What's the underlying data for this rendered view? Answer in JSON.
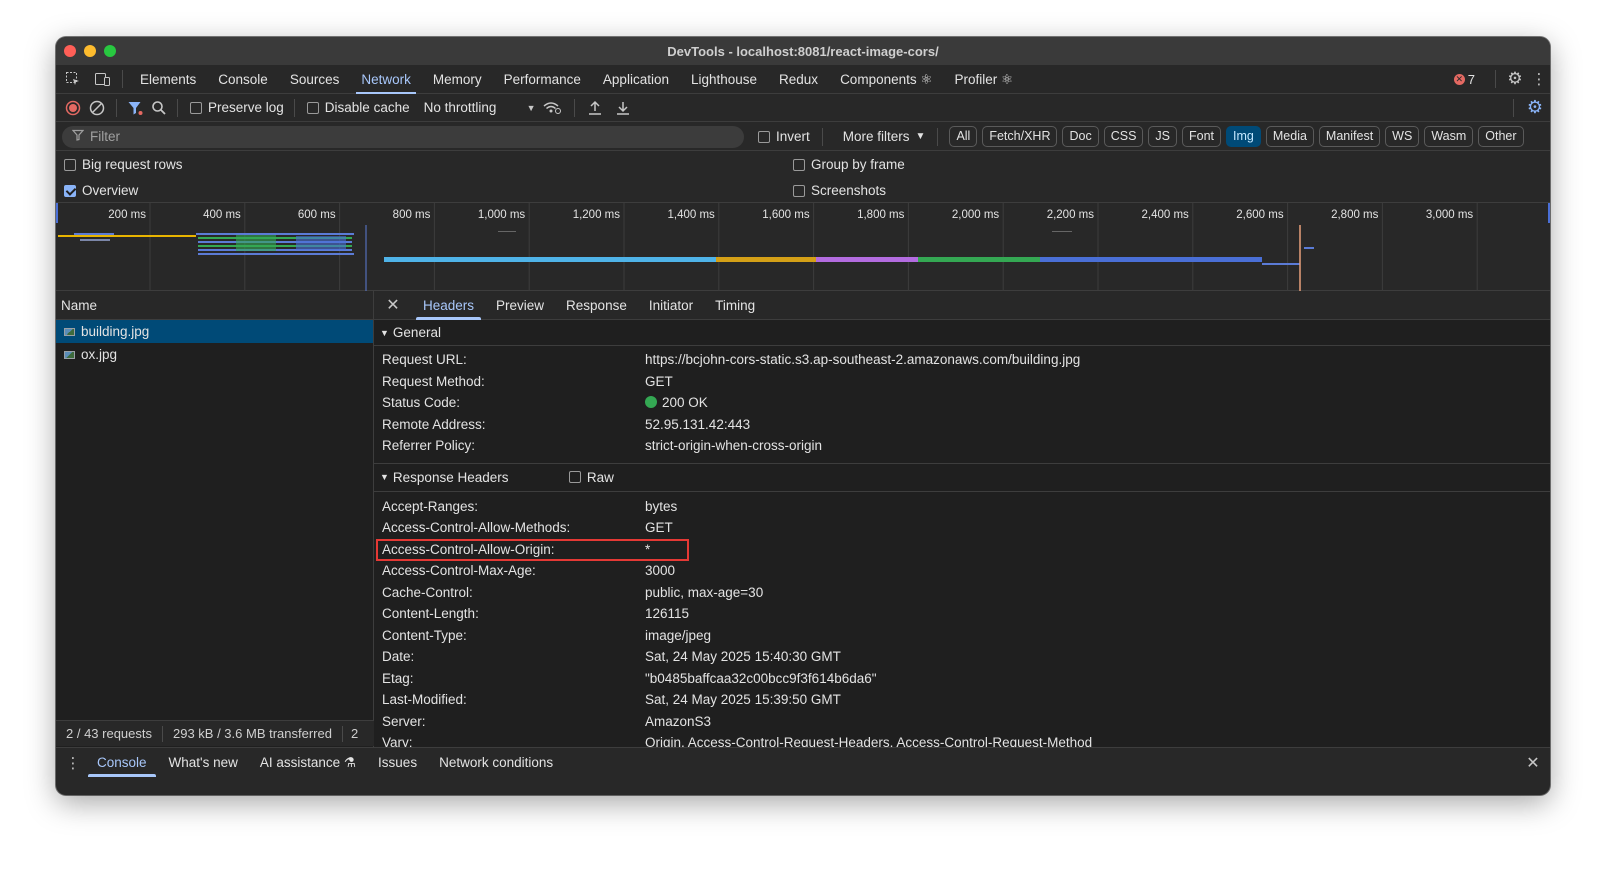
{
  "window": {
    "title": "DevTools - localhost:8081/react-image-cors/"
  },
  "main_tabs": [
    {
      "label": "Elements"
    },
    {
      "label": "Console"
    },
    {
      "label": "Sources"
    },
    {
      "label": "Network",
      "active": true
    },
    {
      "label": "Memory"
    },
    {
      "label": "Performance"
    },
    {
      "label": "Application"
    },
    {
      "label": "Lighthouse"
    },
    {
      "label": "Redux"
    },
    {
      "label": "Components ⚛"
    },
    {
      "label": "Profiler ⚛"
    }
  ],
  "errors": {
    "count": "7"
  },
  "toolbar": {
    "preserve_log": "Preserve log",
    "disable_cache": "Disable cache",
    "throttling": "No throttling"
  },
  "filter": {
    "placeholder": "Filter",
    "invert": "Invert",
    "more_filters": "More filters",
    "chips": [
      "All",
      "Fetch/XHR",
      "Doc",
      "CSS",
      "JS",
      "Font",
      "Img",
      "Media",
      "Manifest",
      "WS",
      "Wasm",
      "Other"
    ],
    "active_chip": "Img"
  },
  "options": {
    "big_rows": "Big request rows",
    "overview": "Overview",
    "group_by_frame": "Group by frame",
    "screenshots": "Screenshots"
  },
  "timeline": {
    "ticks": [
      "200 ms",
      "400 ms",
      "600 ms",
      "800 ms",
      "1,000 ms",
      "1,200 ms",
      "1,400 ms",
      "1,600 ms",
      "1,800 ms",
      "2,000 ms",
      "2,200 ms",
      "2,400 ms",
      "2,600 ms",
      "2,800 ms",
      "3,000 ms"
    ]
  },
  "requests": {
    "header": "Name",
    "items": [
      {
        "name": "building.jpg",
        "selected": true
      },
      {
        "name": "ox.jpg",
        "selected": false
      }
    ],
    "summary": "2 / 43 requests",
    "transferred": "293 kB / 3.6 MB transferred",
    "extra": "2"
  },
  "detail_tabs": [
    {
      "label": "Headers",
      "active": true
    },
    {
      "label": "Preview"
    },
    {
      "label": "Response"
    },
    {
      "label": "Initiator"
    },
    {
      "label": "Timing"
    }
  ],
  "general": {
    "title": "General",
    "rows": [
      {
        "key": "Request URL:",
        "value": "https://bcjohn-cors-static.s3.ap-southeast-2.amazonaws.com/building.jpg"
      },
      {
        "key": "Request Method:",
        "value": "GET"
      },
      {
        "key": "Status Code:",
        "value": "200 OK"
      },
      {
        "key": "Remote Address:",
        "value": "52.95.131.42:443"
      },
      {
        "key": "Referrer Policy:",
        "value": "strict-origin-when-cross-origin"
      }
    ]
  },
  "response_headers": {
    "title": "Response Headers",
    "raw": "Raw",
    "rows": [
      {
        "key": "Accept-Ranges:",
        "value": "bytes"
      },
      {
        "key": "Access-Control-Allow-Methods:",
        "value": "GET"
      },
      {
        "key": "Access-Control-Allow-Origin:",
        "value": "*"
      },
      {
        "key": "Access-Control-Max-Age:",
        "value": "3000"
      },
      {
        "key": "Cache-Control:",
        "value": "public, max-age=30"
      },
      {
        "key": "Content-Length:",
        "value": "126115"
      },
      {
        "key": "Content-Type:",
        "value": "image/jpeg"
      },
      {
        "key": "Date:",
        "value": "Sat, 24 May 2025 15:40:30 GMT"
      },
      {
        "key": "Etag:",
        "value": "\"b0485baffcaa32c00bcc9f3f614b6da6\""
      },
      {
        "key": "Last-Modified:",
        "value": "Sat, 24 May 2025 15:39:50 GMT"
      },
      {
        "key": "Server:",
        "value": "AmazonS3"
      },
      {
        "key": "Vary:",
        "value": "Origin, Access-Control-Request-Headers, Access-Control-Request-Method"
      }
    ]
  },
  "drawer_tabs": [
    {
      "label": "Console",
      "active": true
    },
    {
      "label": "What's new"
    },
    {
      "label": "AI assistance ⚗"
    },
    {
      "label": "Issues"
    },
    {
      "label": "Network conditions"
    }
  ],
  "colors": {
    "accent": "#a8c7fa",
    "record": "#e46962",
    "highlight_box": "#e53935",
    "status_ok": "#34a853"
  }
}
